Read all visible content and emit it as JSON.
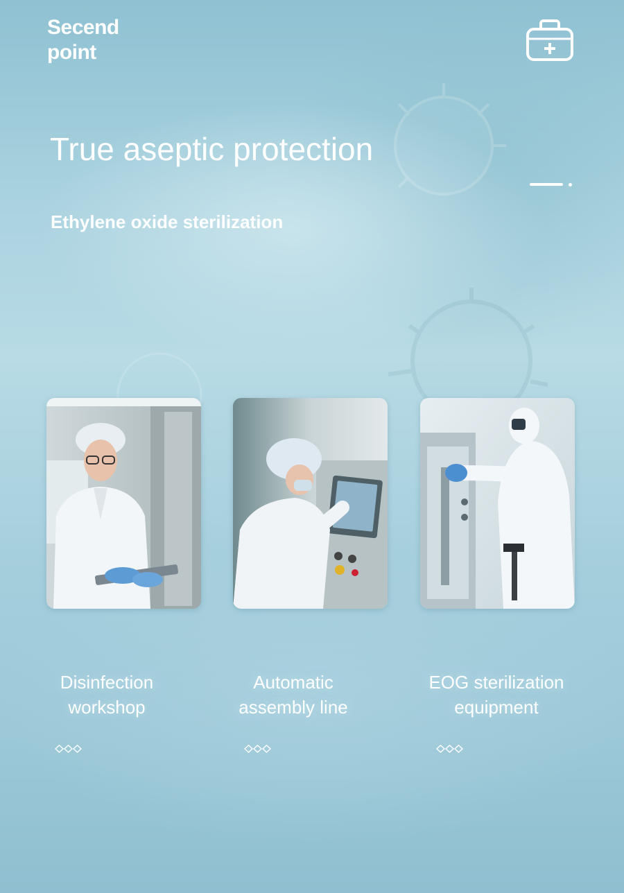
{
  "brand": {
    "line1": "Secend",
    "line2": "point"
  },
  "header": {
    "title": "True aseptic protection",
    "subtitle": "Ethylene oxide sterilization"
  },
  "icons": {
    "kit": "medical-kit-icon",
    "diamonds": "diamond-ornament-icon"
  },
  "colors": {
    "text": "#ffffff",
    "background_top": "#8fc1d2",
    "background_mid": "#b8dbe5"
  },
  "cards": [
    {
      "caption_line1": "Disinfection",
      "caption_line2": "workshop"
    },
    {
      "caption_line1": "Automatic",
      "caption_line2": "assembly line"
    },
    {
      "caption_line1": "EOG sterilization",
      "caption_line2": "equipment"
    }
  ]
}
